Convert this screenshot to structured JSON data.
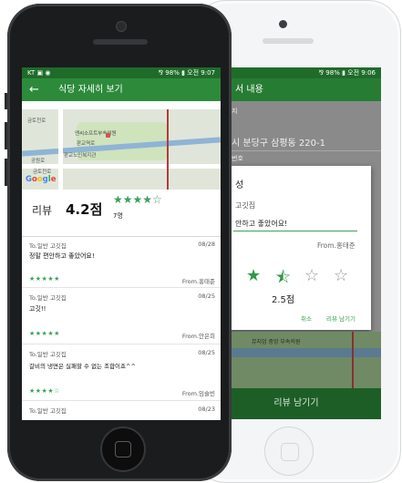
{
  "back_phone": {
    "status": {
      "text": "⅋ 98% ▮ 오전 9:06"
    },
    "appbar_title": "서 내용",
    "bg_lines": [
      "지",
      "시 분당구 삼평동 220-1",
      "번호"
    ],
    "dialog": {
      "title": "성",
      "shop": "고깃집",
      "comment": "안하고 좋았어요!",
      "from": "From.홍태준",
      "stars": [
        "★",
        "⯪",
        "☆",
        "☆"
      ],
      "score": "2.5점",
      "cancel": "취소",
      "submit": "리뷰 남기기"
    },
    "map_label": "뮤지엄 중앙 부속의원",
    "bottom_button": "리뷰 남기기"
  },
  "front_phone": {
    "status": {
      "left": "KT ▣ ◉",
      "right": "⅋ 98% ▮ 오전 9:07"
    },
    "appbar": {
      "back_icon": "←",
      "title": "식당 자세히 보기"
    },
    "map": {
      "labels": [
        "금토천로",
        "엔씨소프트부속의원",
        "판교역로",
        "판교노인복지관",
        "공원로",
        "금토천로"
      ],
      "google": [
        "G",
        "o",
        "o",
        "g",
        "l",
        "e"
      ]
    },
    "summary": {
      "label": "리뷰",
      "score": "4.2점",
      "stars": "★★★★☆",
      "count": "7명"
    },
    "reviews": [
      {
        "to": "To.일반 고깃집",
        "date": "08/28",
        "body": "정말 편안하고 좋았어요!",
        "stars": "★★★★★",
        "from": "From.홍태준"
      },
      {
        "to": "To.일반 고깃집",
        "date": "08/25",
        "body": "고깃!!",
        "stars": "★★★★★",
        "from": "From.안은희"
      },
      {
        "to": "To.일반 고깃집",
        "date": "08/25",
        "body": "갈비의 냉면은 실패할 수 없는 조합이죠^^",
        "stars": "★★★★☆",
        "from": "From.임슬빈"
      },
      {
        "to": "To.일반 고깃집",
        "date": "08/23",
        "body": "",
        "stars": "",
        "from": ""
      }
    ]
  },
  "colors": {
    "primary": "#2d8a3b",
    "primary_dark": "#1f6b2a",
    "star": "#3ba15a"
  }
}
